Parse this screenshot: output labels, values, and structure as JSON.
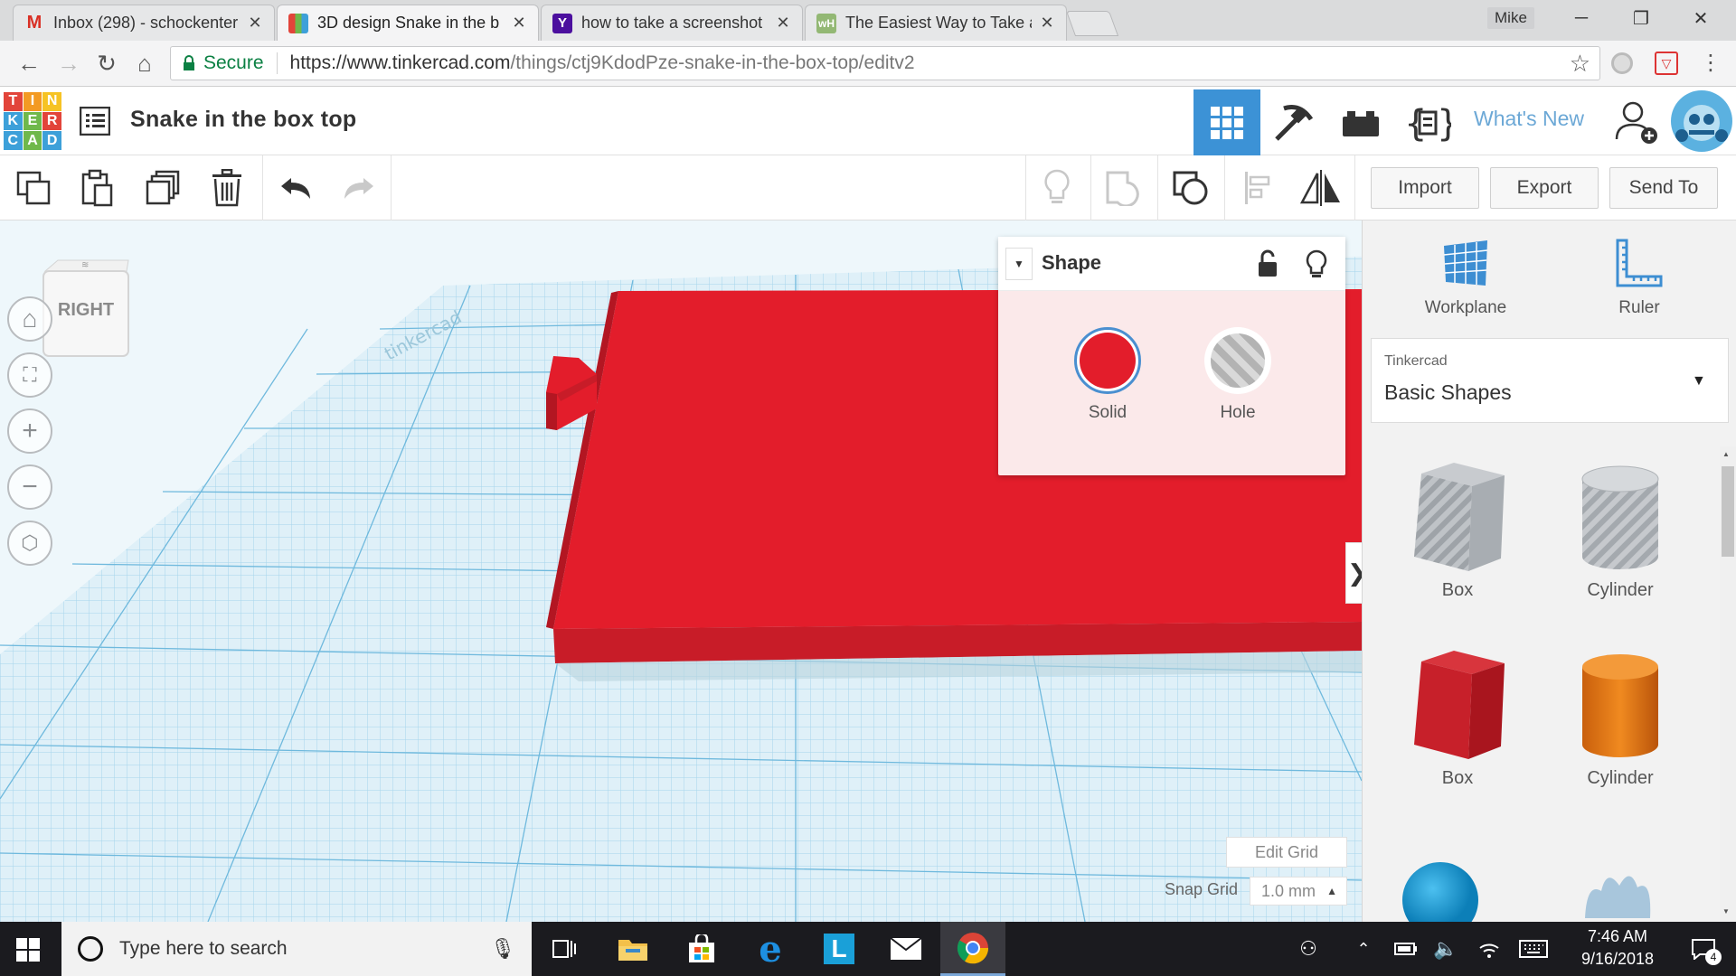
{
  "browser": {
    "tabs": [
      {
        "title": "Inbox (298) - schockenter",
        "icon": "gmail-icon"
      },
      {
        "title": "3D design Snake in the b",
        "icon": "tinkercad-icon"
      },
      {
        "title": "how to take a screenshot",
        "icon": "yahoo-icon"
      },
      {
        "title": "The Easiest Way to Take a",
        "icon": "wikihow-icon"
      }
    ],
    "user": "Mike",
    "secure_label": "Secure",
    "url_host": "https://www.tinkercad.com",
    "url_path": "/things/ctj9KdodPze-snake-in-the-box-top/editv2"
  },
  "app": {
    "logo_letters": [
      "T",
      "I",
      "N",
      "K",
      "E",
      "R",
      "C",
      "A",
      "D"
    ],
    "logo_colors": [
      "#e2443a",
      "#f39a23",
      "#f6c324",
      "#3da0d9",
      "#6fb84b",
      "#e2443a",
      "#3da0d9",
      "#6fb84b",
      "#3da0d9"
    ],
    "design_title": "Snake in the box top",
    "whats_new": "What's New"
  },
  "toolbar": {
    "import": "Import",
    "export": "Export",
    "send_to": "Send To"
  },
  "viewcube": {
    "face": "RIGHT"
  },
  "inspector": {
    "title": "Shape",
    "solid": "Solid",
    "hole": "Hole",
    "solid_color": "#e31d2b"
  },
  "sidepanel": {
    "workplane": "Workplane",
    "ruler": "Ruler",
    "library_provider": "Tinkercad",
    "library_name": "Basic Shapes",
    "shapes": [
      {
        "label": "Box",
        "kind": "box-hole"
      },
      {
        "label": "Cylinder",
        "kind": "cylinder-hole"
      },
      {
        "label": "Box",
        "kind": "box-solid"
      },
      {
        "label": "Cylinder",
        "kind": "cylinder-solid"
      }
    ]
  },
  "grid": {
    "edit_grid": "Edit Grid",
    "snap_label": "Snap Grid",
    "snap_value": "1.0 mm"
  },
  "taskbar": {
    "search_placeholder": "Type here to search",
    "time": "7:46 AM",
    "date": "9/16/2018",
    "notification_count": "4"
  }
}
